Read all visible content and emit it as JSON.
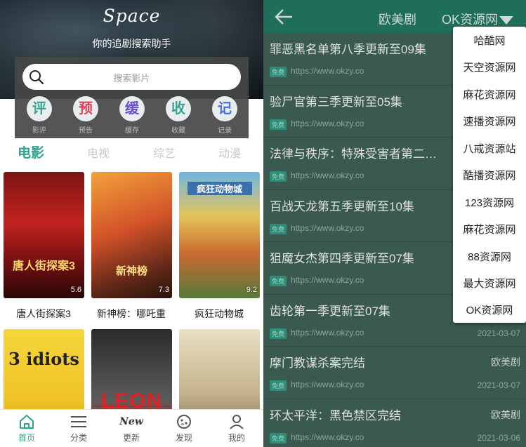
{
  "left": {
    "logo": "Space",
    "subtitle": "你的追剧搜索助手",
    "search_placeholder": "搜索影片",
    "quick": [
      {
        "glyph": "评",
        "label": "影评",
        "color": "#3aa38f"
      },
      {
        "glyph": "预",
        "label": "预告",
        "color": "#e0405c"
      },
      {
        "glyph": "缓",
        "label": "缓存",
        "color": "#6a4fcf"
      },
      {
        "glyph": "收",
        "label": "收藏",
        "color": "#3aa38f"
      },
      {
        "glyph": "记",
        "label": "记录",
        "color": "#4a6ee0"
      }
    ],
    "categories": [
      "电影",
      "电视",
      "综艺",
      "动漫"
    ],
    "movies": [
      {
        "title": "唐人街探案3",
        "rating": "5.6",
        "poster_text": "唐人街探案3"
      },
      {
        "title": "新神榜：哪吒重",
        "rating": "7.3",
        "poster_text": "新神榜"
      },
      {
        "title": "疯狂动物城",
        "rating": "9.2",
        "poster_text": "疯狂动物城"
      },
      {
        "title": "",
        "rating": "",
        "poster_text": "3 idiots"
      },
      {
        "title": "",
        "rating": "",
        "poster_text": "LEON"
      },
      {
        "title": "",
        "rating": "",
        "poster_text": ""
      }
    ],
    "tabs": [
      {
        "label": "首页",
        "icon": "home-icon"
      },
      {
        "label": "分类",
        "icon": "list-icon"
      },
      {
        "label": "更新",
        "icon": "new-icon",
        "icon_text": "New"
      },
      {
        "label": "发现",
        "icon": "discover-icon"
      },
      {
        "label": "我的",
        "icon": "user-icon"
      }
    ],
    "accent": "#2aa58b"
  },
  "right": {
    "title": "欧美剧",
    "source": "OK资源网",
    "rows": [
      {
        "title": "罪恶黑名单第八季更新至09集",
        "badge": "免费",
        "url": "https://www.okzy.co",
        "category": "",
        "date": ""
      },
      {
        "title": "验尸官第三季更新至05集",
        "badge": "免费",
        "url": "https://www.okzy.co",
        "category": "",
        "date": ""
      },
      {
        "title": "法律与秩序：特殊受害者第二…",
        "badge": "免费",
        "url": "https://www.okzy.co",
        "category": "",
        "date": ""
      },
      {
        "title": "百战天龙第五季更新至10集",
        "badge": "免费",
        "url": "https://www.okzy.co",
        "category": "",
        "date": ""
      },
      {
        "title": "狙魔女杰第四季更新至07集",
        "badge": "免费",
        "url": "https://www.okzy.co",
        "category": "",
        "date": ""
      },
      {
        "title": "齿轮第一季更新至07集",
        "badge": "免费",
        "url": "https://www.okzy.co",
        "category": "",
        "date": "2021-03-07"
      },
      {
        "title": "摩门教谋杀案完结",
        "badge": "免费",
        "url": "https://www.okzy.co",
        "category": "欧美剧",
        "date": "2021-03-07"
      },
      {
        "title": "环太平洋：黑色禁区完结",
        "badge": "免费",
        "url": "https://www.okzy.co",
        "category": "欧美剧",
        "date": "2021-03-06"
      }
    ],
    "dropdown": [
      "哈酷网",
      "天空资源网",
      "麻花资源网",
      "速播资源网",
      "八戒资源站",
      "酷播资源网",
      "123资源网",
      "麻花资源网",
      "88资源网",
      "最大资源网",
      "OK资源网"
    ]
  }
}
